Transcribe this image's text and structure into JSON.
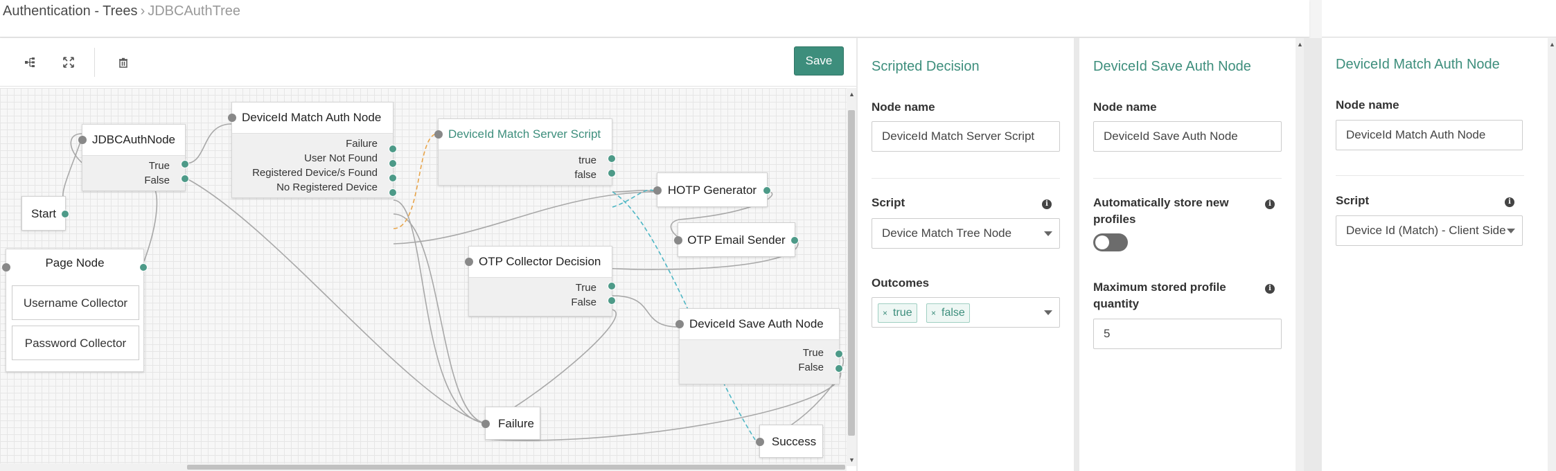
{
  "breadcrumb": {
    "link": "Authentication - Trees",
    "separator": "›",
    "current": "JDBCAuthTree"
  },
  "toolbar": {
    "save_label": "Save"
  },
  "nodes": {
    "jdbc": {
      "title": "JDBCAuthNode",
      "outcomes": [
        "True",
        "False"
      ]
    },
    "start": {
      "title": "Start"
    },
    "page": {
      "title": "Page Node",
      "children": [
        "Username Collector",
        "Password Collector"
      ]
    },
    "match": {
      "title": "DeviceId Match Auth Node",
      "outcomes": [
        "Failure",
        "User Not Found",
        "Registered Device/s Found",
        "No Registered Device"
      ]
    },
    "script": {
      "title": "DeviceId Match Server Script",
      "outcomes": [
        "true",
        "false"
      ]
    },
    "otp_decision": {
      "title": "OTP Collector Decision",
      "outcomes": [
        "True",
        "False"
      ]
    },
    "hotp": {
      "title": "HOTP Generator"
    },
    "otp_email": {
      "title": "OTP Email Sender"
    },
    "save": {
      "title": "DeviceId Save Auth Node",
      "outcomes": [
        "True",
        "False"
      ]
    },
    "failure": {
      "title": "Failure"
    },
    "success": {
      "title": "Success"
    }
  },
  "panel_scripted": {
    "title": "Scripted Decision",
    "node_name_label": "Node name",
    "node_name_value": "DeviceId Match Server Script",
    "script_label": "Script",
    "script_value": "Device Match Tree Node",
    "outcomes_label": "Outcomes",
    "outcomes": [
      "true",
      "false"
    ]
  },
  "panel_save": {
    "title": "DeviceId Save Auth Node",
    "node_name_label": "Node name",
    "node_name_value": "DeviceId Save Auth Node",
    "auto_store_label": "Automatically store new profiles",
    "auto_store_on": false,
    "max_label": "Maximum stored profile quantity",
    "max_value": "5"
  },
  "panel_match": {
    "title": "DeviceId Match Auth Node",
    "node_name_label": "Node name",
    "node_name_value": "DeviceId Match Auth Node",
    "script_label": "Script",
    "script_value": "Device Id (Match) - Client Side"
  },
  "colors": {
    "accent": "#3d8e7c",
    "port_out": "#4d9a88",
    "wire": "#a8a8a8",
    "wire_orange": "#e8a54b",
    "wire_teal": "#4db6c4"
  }
}
